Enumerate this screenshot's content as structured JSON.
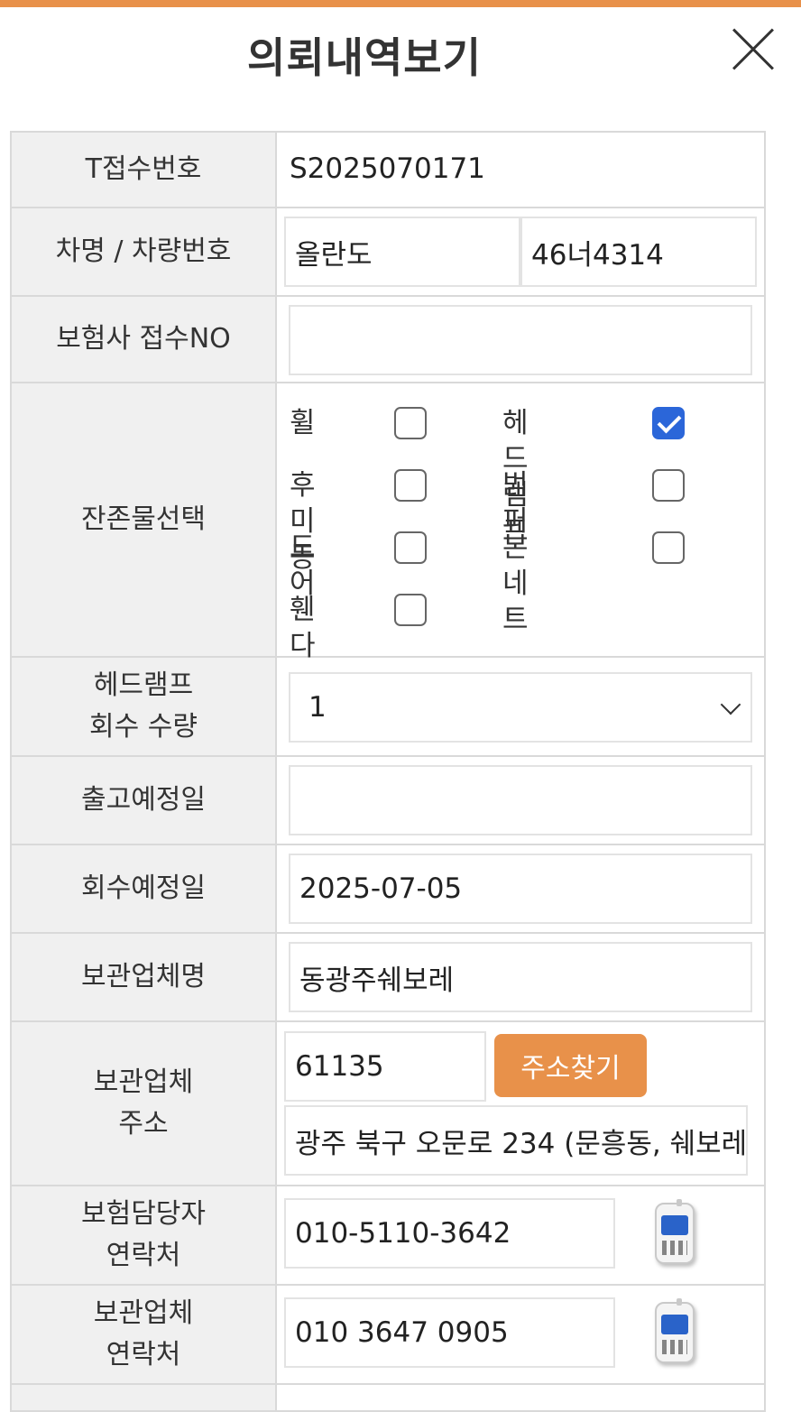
{
  "title": "의뢰내역보기",
  "labels": {
    "receipt_no": "T접수번호",
    "car": "차명 / 차량번호",
    "insurer_receipt": "보험사 접수NO",
    "remains": "잔존물선택",
    "headlamp_qty_1": "헤드램프",
    "headlamp_qty_2": "회수 수량",
    "ship_date": "출고예정일",
    "collect_date": "회수예정일",
    "storage_name": "보관업체명",
    "storage_addr_1": "보관업체",
    "storage_addr_2": "주소",
    "insurance_contact_1": "보험담당자",
    "insurance_contact_2": "연락처",
    "storage_contact_1": "보관업체",
    "storage_contact_2": "연락처"
  },
  "values": {
    "receipt_no": "S2025070171",
    "car_name": "올란도",
    "car_plate": "46너4314",
    "insurer_receipt": "",
    "headlamp_qty": "1",
    "ship_date": "",
    "collect_date": "2025-07-05",
    "storage_name": "동광주쉐보레",
    "zipcode": "61135",
    "address": "광주 북구 오문로 234 (문흥동, 쉐보레",
    "insurance_phone": "010-5110-3642",
    "storage_phone": "010 3647 0905"
  },
  "remains_options": [
    {
      "label": "휠",
      "checked": false
    },
    {
      "label": "헤드램프",
      "checked": true
    },
    {
      "label": "후미등",
      "checked": false
    },
    {
      "label": "범퍼",
      "checked": false
    },
    {
      "label": "도어",
      "checked": false
    },
    {
      "label": "본네트",
      "checked": false
    },
    {
      "label": "휀다",
      "checked": false
    }
  ],
  "buttons": {
    "address_search": "주소찾기"
  },
  "colors": {
    "accent": "#e8914a",
    "checkbox_checked": "#2b66d9",
    "label_bg": "#f0f0f0"
  }
}
